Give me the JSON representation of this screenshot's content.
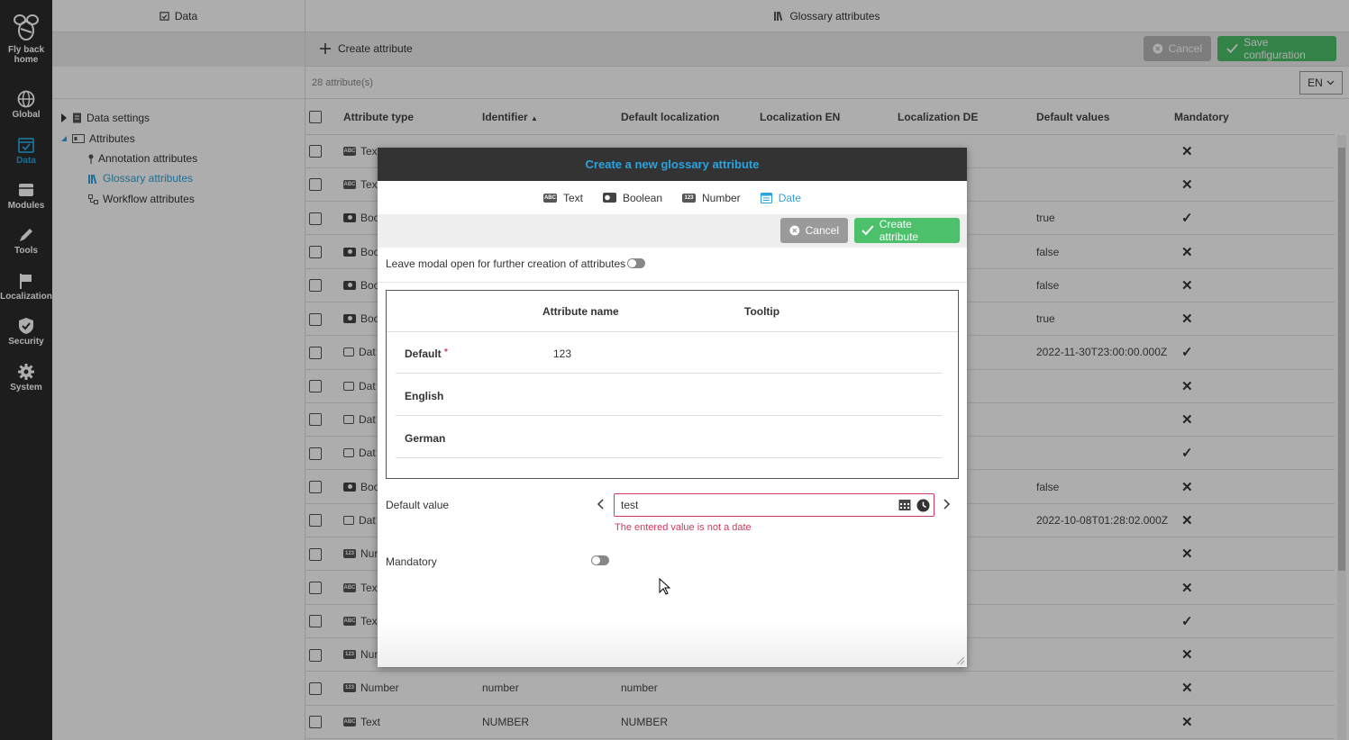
{
  "rail": {
    "items": [
      {
        "label_line1": "Fly back",
        "label_line2": "home",
        "icon": "bee-logo-icon"
      },
      {
        "label_line1": "Global",
        "icon": "globe-icon"
      },
      {
        "label_line1": "Data",
        "icon": "calendar-icon",
        "active": true
      },
      {
        "label_line1": "Modules",
        "icon": "modules-icon"
      },
      {
        "label_line1": "Tools",
        "icon": "pencil-icon"
      },
      {
        "label_line1": "Localization",
        "icon": "flag-icon"
      },
      {
        "label_line1": "Security",
        "icon": "shield-icon"
      },
      {
        "label_line1": "System",
        "icon": "gear-icon"
      }
    ]
  },
  "tree": {
    "header": "Data",
    "nodes": {
      "data_settings": "Data settings",
      "attributes": "Attributes",
      "annotation": "Annotation attributes",
      "glossary": "Glossary attributes",
      "workflow": "Workflow attributes"
    }
  },
  "main": {
    "header": "Glossary attributes",
    "create_label": "Create attribute",
    "cancel_label": "Cancel",
    "save_label": "Save configuration",
    "count": "28 attribute(s)",
    "language": "EN",
    "columns": {
      "type": "Attribute type",
      "identifier": "Identifier",
      "default_loc": "Default localization",
      "loc_en": "Localization EN",
      "loc_de": "Localization DE",
      "default_values": "Default values",
      "mandatory": "Mandatory"
    },
    "rows": [
      {
        "type": "Tex",
        "icon": "text",
        "default_value": "",
        "mandatory": "✕"
      },
      {
        "type": "Tex",
        "icon": "text",
        "default_value": "",
        "mandatory": "✕"
      },
      {
        "type": "Boo",
        "icon": "bool",
        "default_value": "true",
        "mandatory": "✓"
      },
      {
        "type": "Boo",
        "icon": "bool",
        "default_value": "false",
        "mandatory": "✕"
      },
      {
        "type": "Boo",
        "icon": "bool",
        "default_value": "false",
        "mandatory": "✕"
      },
      {
        "type": "Boo",
        "icon": "bool",
        "default_value": "true",
        "mandatory": "✕"
      },
      {
        "type": "Dat",
        "icon": "date",
        "default_value": "2022-11-30T23:00:00.000Z",
        "mandatory": "✓"
      },
      {
        "type": "Dat",
        "icon": "date",
        "default_value": "",
        "mandatory": "✕"
      },
      {
        "type": "Dat",
        "icon": "date",
        "default_value": "",
        "mandatory": "✕"
      },
      {
        "type": "Dat",
        "icon": "date",
        "default_value": "",
        "mandatory": "✓"
      },
      {
        "type": "Boo",
        "icon": "bool",
        "default_value": "false",
        "mandatory": "✕"
      },
      {
        "type": "Dat",
        "icon": "date",
        "default_value": "2022-10-08T01:28:02.000Z",
        "mandatory": "✕"
      },
      {
        "type": "Nur",
        "icon": "num",
        "default_value": "",
        "mandatory": "✕"
      },
      {
        "type": "Tex",
        "icon": "text",
        "default_value": "",
        "mandatory": "✕"
      },
      {
        "type": "Tex",
        "icon": "text",
        "default_value": "",
        "mandatory": "✓"
      },
      {
        "type": "Nur",
        "icon": "num",
        "default_value": "",
        "mandatory": "✕"
      },
      {
        "type": "Number",
        "icon": "num",
        "identifier": "number",
        "default_loc": "number",
        "default_value": "",
        "mandatory": "✕"
      },
      {
        "type": "Text",
        "icon": "text",
        "identifier": "NUMBER",
        "default_loc": "NUMBER",
        "default_value": "",
        "mandatory": "✕"
      }
    ]
  },
  "modal": {
    "title": "Create a new glossary attribute",
    "tabs": {
      "text": "Text",
      "boolean": "Boolean",
      "number": "Number",
      "date": "Date"
    },
    "cancel_label": "Cancel",
    "create_label": "Create attribute",
    "leave_open_label": "Leave modal open for further creation of attributes",
    "loc_headers": {
      "name": "Attribute name",
      "tooltip": "Tooltip"
    },
    "loc_rows": {
      "default_label": "Default",
      "required_mark": "*",
      "default_name": "123",
      "english_label": "English",
      "german_label": "German"
    },
    "default_value_label": "Default value",
    "date_value": "test",
    "error": "The entered value is not a date",
    "mandatory_label": "Mandatory"
  },
  "colors": {
    "accent": "#2aa4e0",
    "success": "#4cc06a",
    "error": "#d2395b",
    "rail": "#2b2b2b"
  }
}
